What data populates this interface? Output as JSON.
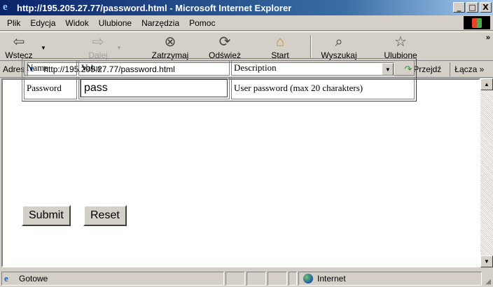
{
  "window": {
    "title": "http://195.205.27.77/password.html - Microsoft Internet Explorer",
    "buttons": [
      "_",
      "□",
      "X"
    ]
  },
  "menu": {
    "items": [
      "Plik",
      "Edycja",
      "Widok",
      "Ulubione",
      "Narzędzia",
      "Pomoc"
    ]
  },
  "toolbar": {
    "back": "Wstecz",
    "forward": "Dalej",
    "stop": "Zatrzymaj",
    "refresh": "Odśwież",
    "home": "Start",
    "search": "Wyszukaj",
    "favorites": "Ulubione",
    "more": "»"
  },
  "address": {
    "label": "Adres",
    "url": "http://195.205.27.77/password.html",
    "go": "Przejdź",
    "links": "Łącza »"
  },
  "form_table": {
    "headers": [
      "Name",
      "Value",
      "Description"
    ],
    "row": {
      "name": "Password",
      "value": "pass",
      "description": "User password (max 20 charakters)"
    }
  },
  "buttons": {
    "submit": "Submit",
    "reset": "Reset"
  },
  "status": {
    "text": "Gotowe",
    "zone": "Internet"
  },
  "colors": {
    "titlebar": "#0a246a",
    "chrome": "#d4d0c8"
  }
}
